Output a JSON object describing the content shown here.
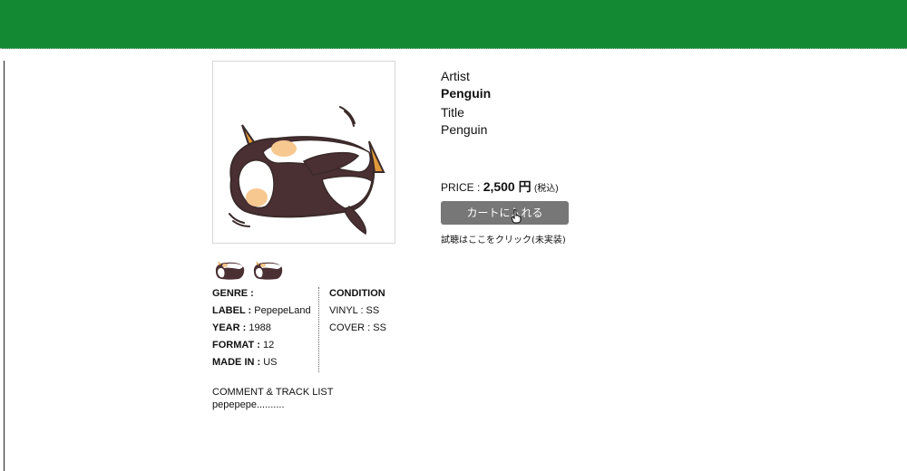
{
  "colors": {
    "header_bg": "#138934",
    "button_bg": "#777777",
    "button_text": "#ffffff"
  },
  "product": {
    "image_icon": "penguin-illustration",
    "thumbnail_icons": [
      "penguin-thumbnail",
      "penguin-thumbnail"
    ],
    "artist_label": "Artist",
    "artist": "Penguin",
    "title_label": "Title",
    "title": "Penguin",
    "price_label": "PRICE :",
    "price_amount": "2,500 円",
    "price_tax": "(税込)",
    "cart_button": "カートに入れる",
    "listen_link": "試聴はここをクリック(未実装)"
  },
  "specs": {
    "genre_label": "GENRE :",
    "genre_value": "",
    "label_label": "LABEL :",
    "label_value": "PepepeLand",
    "year_label": "YEAR :",
    "year_value": "1988",
    "format_label": "FORMAT :",
    "format_value": "12",
    "made_in_label": "MADE IN :",
    "made_in_value": "US",
    "condition_heading": "CONDITION",
    "vinyl": "VINYL : SS",
    "cover": "COVER : SS"
  },
  "comment": {
    "heading": "COMMENT & TRACK LIST",
    "text": "pepepepe.........."
  }
}
